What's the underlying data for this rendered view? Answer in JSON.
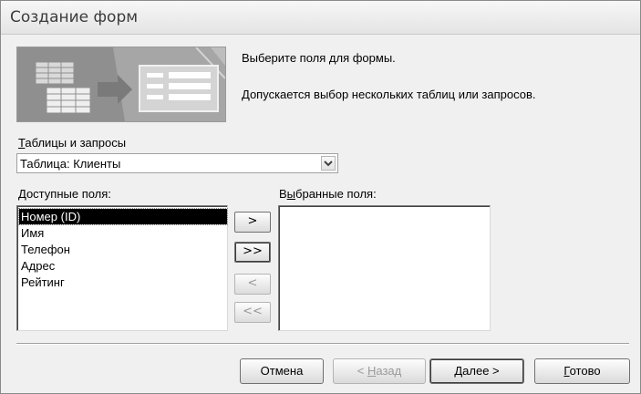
{
  "window": {
    "title": "Создание форм"
  },
  "intro": {
    "line1": "Выберите поля для формы.",
    "line2": "Допускается выбор нескольких таблиц или запросов."
  },
  "tables": {
    "label_underlined": "Т",
    "label_rest": "аблицы и запросы",
    "selected_value": "Таблица: Клиенты"
  },
  "available": {
    "label_underlined": "Д",
    "label_rest": "оступные поля:",
    "items": [
      "Номер (ID)",
      "Имя",
      "Телефон",
      "Адрес",
      "Рейтинг"
    ],
    "selected_index": 0
  },
  "selected": {
    "label_before": "В",
    "label_underlined": "ы",
    "label_rest": "бранные поля:",
    "items": []
  },
  "move_buttons": {
    "add_one": ">",
    "add_all": ">>",
    "remove_one": "<",
    "remove_all": "<<"
  },
  "footer": {
    "cancel": "Отмена",
    "back_prefix": "< ",
    "back_underlined": "Н",
    "back_rest": "азад",
    "next_underlined": "Д",
    "next_rest": "алее >",
    "finish_underlined": "Г",
    "finish_rest": "отово"
  },
  "colors": {
    "window_bg": "#f0f0f0",
    "selection_bg": "#000000",
    "disabled_text": "#9a9a9a"
  }
}
